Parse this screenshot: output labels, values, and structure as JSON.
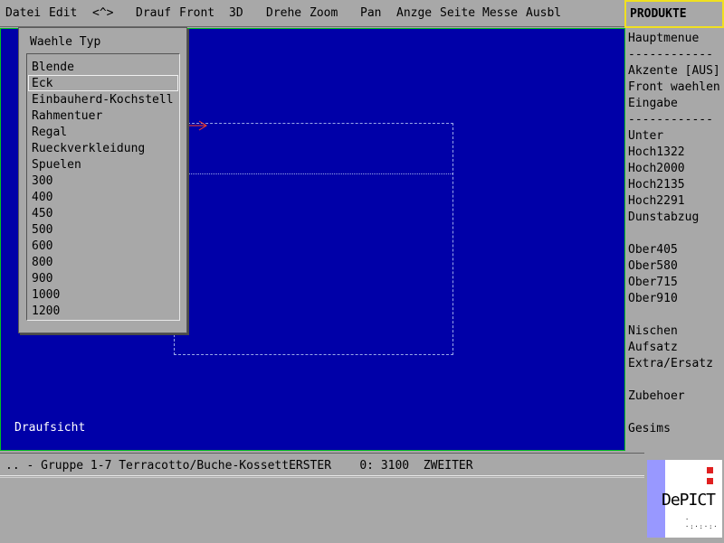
{
  "menubar": {
    "items": [
      "Datei",
      "Edit",
      "<^>",
      "Drauf",
      "Front",
      "3D",
      "Drehe",
      "Zoom",
      "Pan",
      "Anzge",
      "Seite",
      "Messe",
      "Ausbl"
    ]
  },
  "panel": {
    "title": "PRODUKTE",
    "items": [
      {
        "label": "Hauptmenue"
      },
      {
        "label": "------------",
        "sep": true
      },
      {
        "label": "Akzente [AUS]"
      },
      {
        "label": "Front waehlen"
      },
      {
        "label": "Eingabe"
      },
      {
        "label": "------------",
        "sep": true
      },
      {
        "label": "Unter"
      },
      {
        "label": "Hoch1322"
      },
      {
        "label": "Hoch2000"
      },
      {
        "label": "Hoch2135"
      },
      {
        "label": "Hoch2291"
      },
      {
        "label": "Dunstabzug"
      },
      {
        "label": ""
      },
      {
        "label": "Ober405"
      },
      {
        "label": "Ober580"
      },
      {
        "label": "Ober715"
      },
      {
        "label": "Ober910"
      },
      {
        "label": ""
      },
      {
        "label": "Nischen"
      },
      {
        "label": "Aufsatz"
      },
      {
        "label": "Extra/Ersatz"
      },
      {
        "label": ""
      },
      {
        "label": "Zubehoer"
      },
      {
        "label": ""
      },
      {
        "label": "Gesims"
      }
    ]
  },
  "dropdown": {
    "title": "Waehle Typ",
    "selected_index": 1,
    "items": [
      "Blende",
      "Eck",
      "Einbauherd-Kochstell",
      "Rahmentuer",
      "Regal",
      "Rueckverkleidung",
      "Spuelen",
      "300",
      "400",
      "450",
      "500",
      "600",
      "800",
      "900",
      "1000",
      "1200"
    ]
  },
  "canvas": {
    "view_label": "Draufsicht"
  },
  "status": {
    "text": ".. - Gruppe 1-7 Terracotto/Buche-KossettERSTER    0: 3100  ZWEITER"
  },
  "logo": {
    "text": "DePICT"
  },
  "colors": {
    "canvas_bg": "#0000a8",
    "panel_title_border": "#f0e020",
    "arrow": "#ff4020"
  }
}
